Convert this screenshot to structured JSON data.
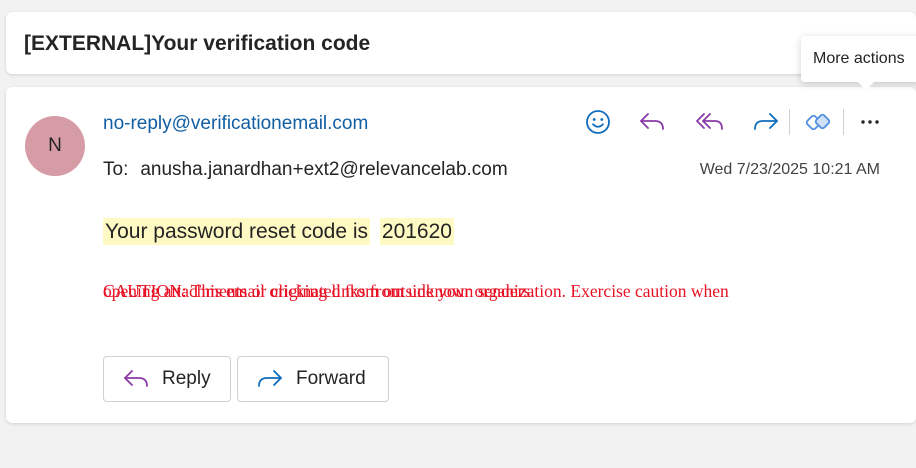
{
  "subject": {
    "title": "[EXTERNAL]Your verification code"
  },
  "tooltip": {
    "text": "More actions"
  },
  "message": {
    "avatar_initial": "N",
    "sender": "no-reply@verificationemail.com",
    "to_label": "To:",
    "to_address": "anusha.janardhan+ext2@relevancelab.com",
    "date": "Wed 7/23/2025 10:21 AM",
    "body_text": "Your password reset code is",
    "code": "201620",
    "caution_line_1": "CAUTION: This email originated from outside your organization. Exercise caution when",
    "caution_line_2": "opening attachments or clicking links from unknown senders."
  },
  "toolbar": {
    "icons": [
      "emoji-icon",
      "reply-icon",
      "reply-all-icon",
      "forward-icon",
      "apps-icon",
      "more-actions-icon"
    ],
    "accent_color": "#8a3aa8",
    "blue_color": "#0f6cbd"
  },
  "actions": {
    "reply_label": "Reply",
    "forward_label": "Forward"
  }
}
